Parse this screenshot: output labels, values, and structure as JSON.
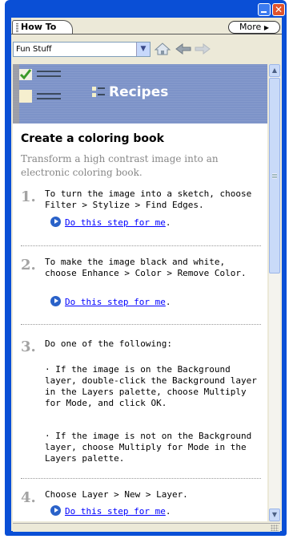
{
  "window": {
    "tab_label": "How To",
    "more_label": "More",
    "minimize_icon": "minimize-icon",
    "close_icon": "close-icon",
    "close_glyph": "✕"
  },
  "toolbar": {
    "topic_selected": "Fun Stuff",
    "home_icon": "home-icon",
    "back_icon": "back-arrow-icon",
    "forward_icon": "forward-arrow-icon"
  },
  "banner": {
    "title": "Recipes",
    "icon": "recipe-checklist-icon"
  },
  "recipe": {
    "heading": "Create a coloring book",
    "intro": "Transform a high contrast image into an electronic coloring book.",
    "steps": [
      {
        "number": "1.",
        "text": "To turn the image into a sketch, choose Filter > Stylize > Find Edges.",
        "action": "Do this step for me",
        "action_suffix": "."
      },
      {
        "number": "2.",
        "text": "To make the image black and white, choose Enhance > Color > Remove Color.",
        "action": "Do this step for me",
        "action_suffix": "."
      },
      {
        "number": "3.",
        "text": "Do one of the following:",
        "options": [
          "· If the image is on the Background layer, double-click the Background layer in the Layers palette, choose Multiply for Mode, and click OK.",
          "· If the image is not on the Background layer, choose Multiply for Mode in the Layers palette."
        ]
      },
      {
        "number": "4.",
        "text": "Choose Layer > New > Layer.",
        "action": "Do this step for me",
        "action_suffix": "."
      }
    ]
  },
  "colors": {
    "frame": "#0a4fd6",
    "banner": "#7d93c8",
    "link": "#0000ff",
    "step_number": "#a3a3a3"
  }
}
